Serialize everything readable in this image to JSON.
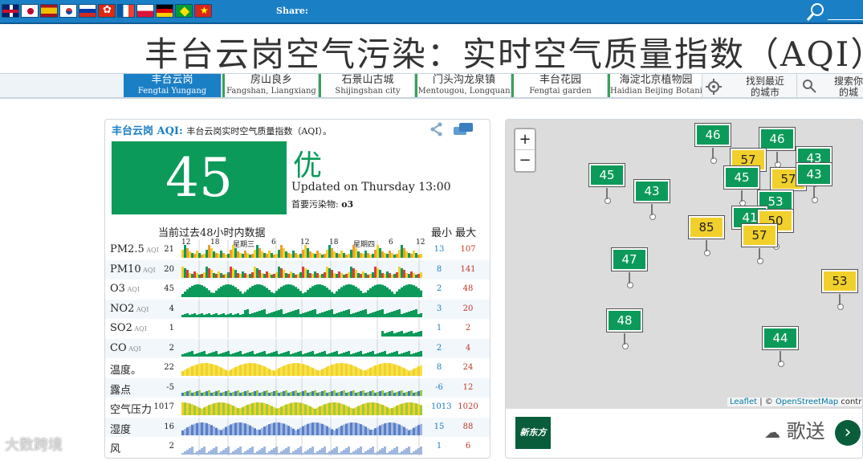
{
  "topbar": {
    "flags": [
      "gb",
      "jp",
      "es",
      "kr",
      "ru",
      "hk",
      "fr",
      "pl",
      "de",
      "br",
      "vn"
    ],
    "share_label": "Share:",
    "search_icon": "search-icon"
  },
  "page_title": "丰台云岗空气污染：实时空气质量指数（AQI）",
  "tabs": [
    {
      "label": "丰台云岗",
      "sub": "Fengtai Yungang",
      "active": true
    },
    {
      "label": "房山良乡",
      "sub": "Fangshan, Liangxiang"
    },
    {
      "label": "石景山古城",
      "sub": "Shijingshan city"
    },
    {
      "label": "门头沟龙泉镇",
      "sub": "Mentougou, Longquan"
    },
    {
      "label": "丰台花园",
      "sub": "Fengtai garden"
    },
    {
      "label": "海淀北京植物园",
      "sub": "Haidian Beijing Botanical"
    },
    {
      "label": "找到最近的城市",
      "sub": ""
    },
    {
      "label": "搜索你的城",
      "sub": ""
    }
  ],
  "panel": {
    "station": "丰台云岗 AQI",
    "desc": "丰台云岗实时空气质量指数（AQI）。",
    "aqi": "45",
    "level": "优",
    "updated": "Updated on Thursday 13:00",
    "primary_pollutant_label": "首要污染物:",
    "primary_pollutant": "o3",
    "history_label": "当前过去48小时内数据",
    "min_label": "最小",
    "max_label": "最大",
    "ticks": [
      "12",
      "18",
      "星期三",
      "6",
      "12",
      "18",
      "星期四",
      "6",
      "12"
    ],
    "rows": [
      {
        "name": "PM2.5",
        "unit": "AQI",
        "value": "21",
        "min": "13",
        "max": "107"
      },
      {
        "name": "PM10",
        "unit": "AQI",
        "value": "20",
        "min": "8",
        "max": "141"
      },
      {
        "name": "O3",
        "unit": "AQI",
        "value": "45",
        "min": "2",
        "max": "48"
      },
      {
        "name": "NO2",
        "unit": "AQI",
        "value": "4",
        "min": "3",
        "max": "20"
      },
      {
        "name": "SO2",
        "unit": "AQI",
        "value": "1",
        "min": "1",
        "max": "2"
      },
      {
        "name": "CO",
        "unit": "AQI",
        "value": "2",
        "min": "2",
        "max": "4"
      },
      {
        "name": "温度。",
        "unit": "",
        "value": "22",
        "min": "8",
        "max": "24"
      },
      {
        "name": "露点",
        "unit": "",
        "value": "-5",
        "min": "-6",
        "max": "12"
      },
      {
        "name": "空气压力",
        "unit": "",
        "value": "1017",
        "min": "1013",
        "max": "1020"
      },
      {
        "name": "湿度",
        "unit": "",
        "value": "16",
        "min": "15",
        "max": "88"
      },
      {
        "name": "风",
        "unit": "",
        "value": "2",
        "min": "1",
        "max": "6"
      }
    ]
  },
  "map": {
    "zoom_in": "+",
    "zoom_out": "−",
    "markers": [
      {
        "v": "46",
        "c": "g"
      },
      {
        "v": "46",
        "c": "g"
      },
      {
        "v": "57",
        "c": "y"
      },
      {
        "v": "45",
        "c": "g"
      },
      {
        "v": "43",
        "c": "g"
      },
      {
        "v": "45",
        "c": "g"
      },
      {
        "v": "57",
        "c": "y"
      },
      {
        "v": "43",
        "c": "g"
      },
      {
        "v": "43",
        "c": "g"
      },
      {
        "v": "53",
        "c": "g"
      },
      {
        "v": "41",
        "c": "g"
      },
      {
        "v": "50",
        "c": "y"
      },
      {
        "v": "85",
        "c": "y"
      },
      {
        "v": "57",
        "c": "y"
      },
      {
        "v": "47",
        "c": "g"
      },
      {
        "v": "53",
        "c": "y"
      },
      {
        "v": "48",
        "c": "g"
      },
      {
        "v": "44",
        "c": "g"
      }
    ],
    "attribution_leaflet": "Leaflet",
    "attribution_sep": " | © ",
    "attribution_osm": "OpenStreetMap",
    "attribution_tail": " contrib",
    "ad_logo": "新东方",
    "watermark_right": "歌送"
  },
  "watermark_left": "大数跨境",
  "colors": {
    "green": "#0c9a5a",
    "yellow": "#f2d02c",
    "blue": "#1b7fc6"
  }
}
